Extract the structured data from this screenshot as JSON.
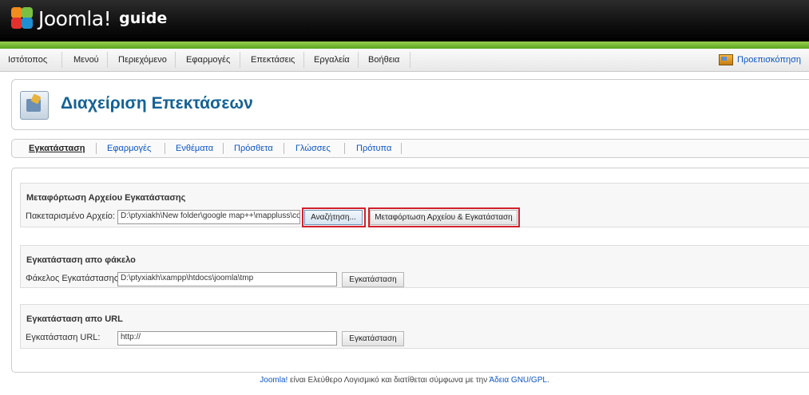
{
  "header": {
    "logo_text": "Joomla!",
    "logo_suffix": "guide"
  },
  "menu": {
    "items": [
      "Ιστότοπος",
      "Μενού",
      "Περιεχόμενο",
      "Εφαρμογές",
      "Επεκτάσεις",
      "Εργαλεία",
      "Βοήθεια"
    ],
    "preview_label": "Προεπισκόπηση"
  },
  "page": {
    "title": "Διαχείριση Επεκτάσεων"
  },
  "subtabs": {
    "items": [
      "Εγκατάσταση",
      "Εφαρμογές",
      "Ενθέματα",
      "Πρόσθετα",
      "Γλώσσες",
      "Πρότυπα"
    ],
    "active": "Εγκατάσταση"
  },
  "upload": {
    "title": "Μεταφόρτωση Αρχείου Εγκατάστασης",
    "label": "Πακεταρισμένο Αρχείο:",
    "value": "D:\\ptyxiakh\\New folder\\google map++\\mappluss\\com",
    "browse_label": "Αναζήτηση...",
    "submit_label": "Μεταφόρτωση Αρχείου & Εγκατάσταση"
  },
  "folder": {
    "title": "Εγκατάσταση απο φάκελο",
    "label": "Φάκελος Εγκατάστασης:",
    "value": "D:\\ptyxiakh\\xampp\\htdocs\\joomla\\tmp",
    "button_label": "Εγκατάσταση"
  },
  "url": {
    "title": "Εγκατάσταση απο URL",
    "label": "Εγκατάσταση URL:",
    "value": "http://",
    "button_label": "Εγκατάσταση"
  },
  "footer": {
    "brand": "Joomla!",
    "text": " είναι Ελεύθερο Λογισμικό και διατίθεται σύμφωνα με την ",
    "license": "Άδεια GNU/GPL",
    "end": "."
  },
  "colors": {
    "accent_green": "#5aa51d",
    "link_blue": "#0b55c4",
    "title_blue": "#146295",
    "highlight_red": "#d2212b"
  }
}
